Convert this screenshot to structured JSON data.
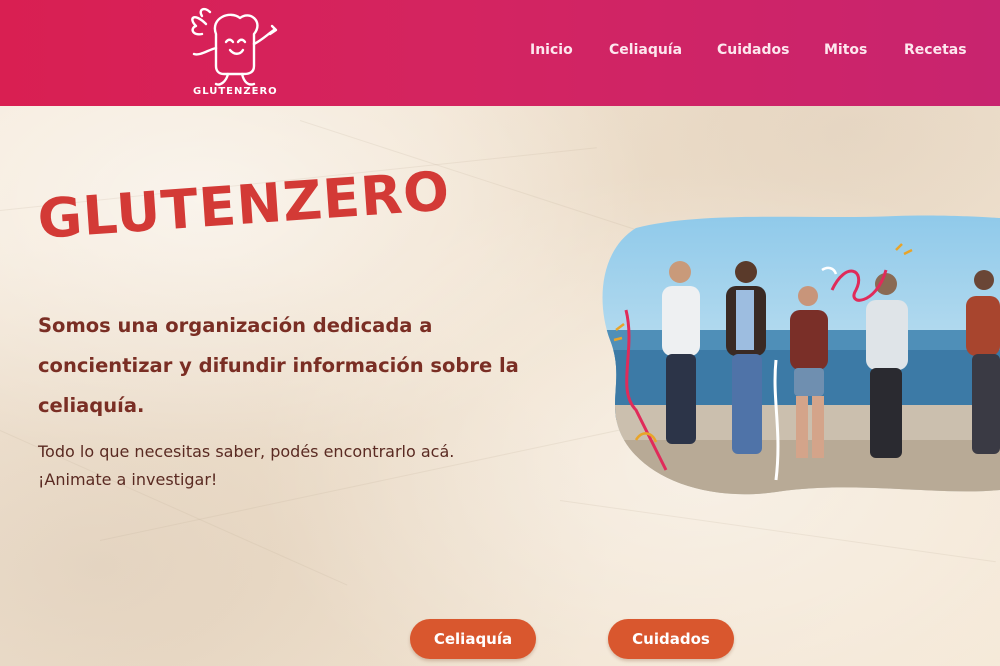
{
  "brand": {
    "name": "GLUTENZERO",
    "primary_color": "#d91f52",
    "accent_color": "#d9572e",
    "title_color": "#d33a36"
  },
  "nav": {
    "items": [
      {
        "label": "Inicio"
      },
      {
        "label": "Celiaquía"
      },
      {
        "label": "Cuidados"
      },
      {
        "label": "Mitos"
      },
      {
        "label": "Recetas"
      }
    ]
  },
  "hero": {
    "title": "GLUTENZERO",
    "lead": "Somos una organización dedicada a concientizar y difundir información sobre la celiaquía.",
    "sub_line1": "Todo lo que necesitas saber, podés encontrarlo acá.",
    "sub_line2": "¡Animate a investigar!"
  },
  "buttons": {
    "celiaquia": "Celiaquía",
    "cuidados": "Cuidados"
  }
}
